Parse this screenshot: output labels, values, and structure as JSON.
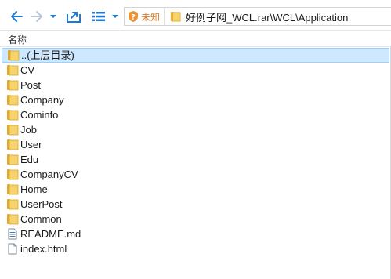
{
  "address": {
    "security_label": "未知",
    "path": "好例子网_WCL.rar\\WCL\\Application"
  },
  "columns": {
    "name": "名称"
  },
  "files": [
    {
      "name": "..(上层目录)",
      "type": "folder",
      "selected": true
    },
    {
      "name": "CV",
      "type": "folder"
    },
    {
      "name": "Post",
      "type": "folder"
    },
    {
      "name": "Company",
      "type": "folder"
    },
    {
      "name": "Cominfo",
      "type": "folder"
    },
    {
      "name": "Job",
      "type": "folder"
    },
    {
      "name": "User",
      "type": "folder"
    },
    {
      "name": "Edu",
      "type": "folder"
    },
    {
      "name": "CompanyCV",
      "type": "folder"
    },
    {
      "name": "Home",
      "type": "folder"
    },
    {
      "name": "UserPost",
      "type": "folder"
    },
    {
      "name": "Common",
      "type": "folder"
    },
    {
      "name": "README.md",
      "type": "md-file"
    },
    {
      "name": "index.html",
      "type": "file"
    }
  ],
  "icons": {
    "back": "arrow-left-icon",
    "forward": "arrow-right-icon",
    "history": "chevron-down-icon",
    "up": "folder-up-icon",
    "view": "list-view-icon",
    "view_dropdown": "chevron-down-icon",
    "security": "shield-icon",
    "folder": "folder-icon"
  },
  "colors": {
    "accent": "#1e7ad8",
    "security": "#d9822b",
    "folder": "#e8b53c",
    "selection_bg": "#cde8ff",
    "selection_border": "#99d1ff"
  }
}
